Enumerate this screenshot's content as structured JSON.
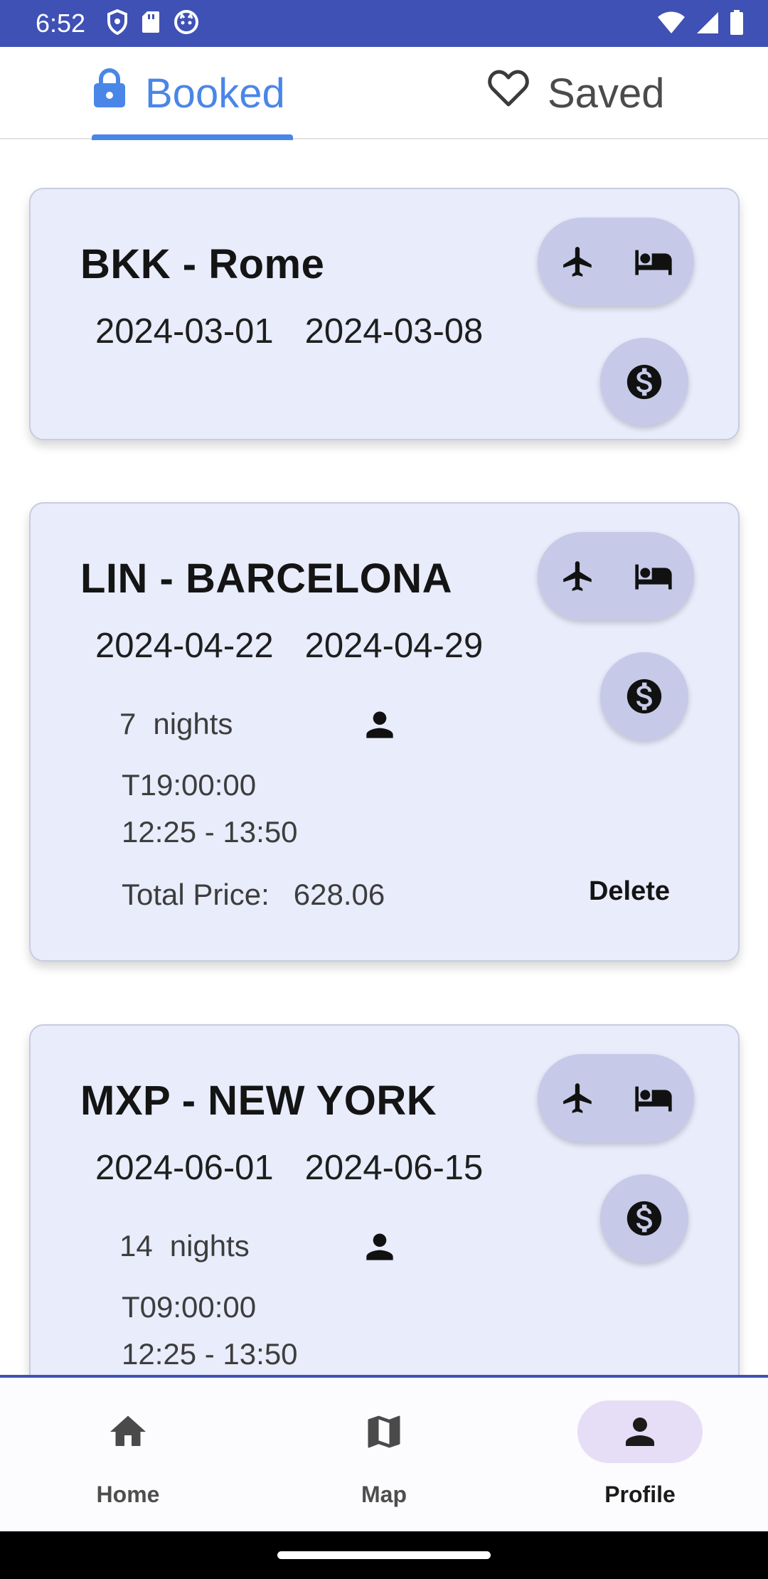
{
  "status_bar": {
    "time": "6:52",
    "left_icons": [
      "shield-icon",
      "sd-card-icon",
      "cat-face-icon"
    ],
    "right_icons": [
      "wifi-icon",
      "signal-icon",
      "battery-icon"
    ],
    "background": "#3f51b5"
  },
  "tabs": [
    {
      "label": "Booked",
      "icon": "lock-icon",
      "active": true
    },
    {
      "label": "Saved",
      "icon": "heart-outline-icon",
      "active": false
    }
  ],
  "colors": {
    "accent": "#4a86e8",
    "card_bg": "#e8ecfb",
    "button_bg": "#c6cae8"
  },
  "trips": [
    {
      "title": "BKK - Rome",
      "start_date": "2024-03-01",
      "end_date": "2024-03-08"
    },
    {
      "title": "LIN - BARCELONA",
      "start_date": "2024-04-22",
      "end_date": "2024-04-29",
      "nights": "7",
      "nights_label": "nights",
      "departure_time": "T19:00:00",
      "flight_window": "12:25 - 13:50",
      "total_label": "Total Price:",
      "total_price": "628.06",
      "delete_label": "Delete"
    },
    {
      "title": "MXP - NEW YORK",
      "start_date": "2024-06-01",
      "end_date": "2024-06-15",
      "nights": "14",
      "nights_label": "nights",
      "departure_time": "T09:00:00",
      "flight_window": "12:25 - 13:50"
    }
  ],
  "bottom_nav": [
    {
      "label": "Home",
      "icon": "home-icon",
      "active": false
    },
    {
      "label": "Map",
      "icon": "map-icon",
      "active": false
    },
    {
      "label": "Profile",
      "icon": "person-icon",
      "active": true
    }
  ]
}
